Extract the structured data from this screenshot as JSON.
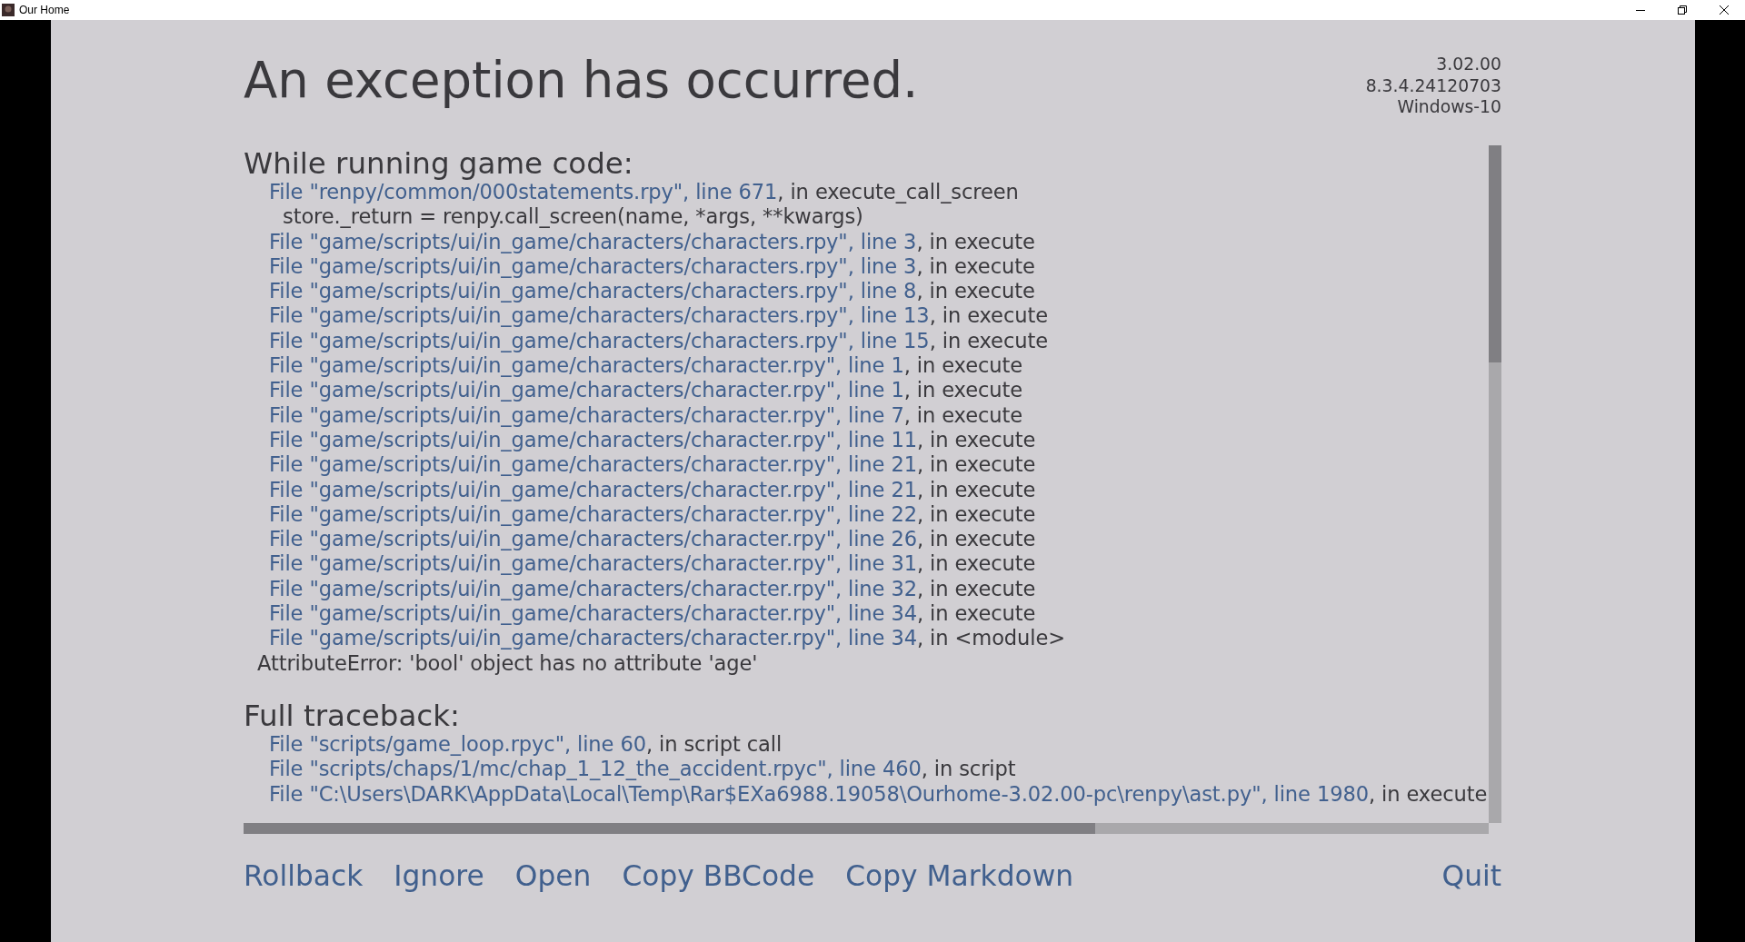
{
  "window": {
    "title": "Our Home"
  },
  "title": "An exception has occurred.",
  "version_info": [
    "3.02.00",
    "8.3.4.24120703",
    "Windows-10"
  ],
  "sections": [
    {
      "heading": "While running game code:",
      "entries": [
        {
          "kind": "frame",
          "link": "File \"renpy/common/000statements.rpy\", line 671",
          "rest": ", in execute_call_screen"
        },
        {
          "kind": "code",
          "text": "store._return = renpy.call_screen(name, *args, **kwargs)"
        },
        {
          "kind": "frame",
          "link": "File \"game/scripts/ui/in_game/characters/characters.rpy\", line 3",
          "rest": ", in execute"
        },
        {
          "kind": "frame",
          "link": "File \"game/scripts/ui/in_game/characters/characters.rpy\", line 3",
          "rest": ", in execute"
        },
        {
          "kind": "frame",
          "link": "File \"game/scripts/ui/in_game/characters/characters.rpy\", line 8",
          "rest": ", in execute"
        },
        {
          "kind": "frame",
          "link": "File \"game/scripts/ui/in_game/characters/characters.rpy\", line 13",
          "rest": ", in execute"
        },
        {
          "kind": "frame",
          "link": "File \"game/scripts/ui/in_game/characters/characters.rpy\", line 15",
          "rest": ", in execute"
        },
        {
          "kind": "frame",
          "link": "File \"game/scripts/ui/in_game/characters/character.rpy\", line 1",
          "rest": ", in execute"
        },
        {
          "kind": "frame",
          "link": "File \"game/scripts/ui/in_game/characters/character.rpy\", line 1",
          "rest": ", in execute"
        },
        {
          "kind": "frame",
          "link": "File \"game/scripts/ui/in_game/characters/character.rpy\", line 7",
          "rest": ", in execute"
        },
        {
          "kind": "frame",
          "link": "File \"game/scripts/ui/in_game/characters/character.rpy\", line 11",
          "rest": ", in execute"
        },
        {
          "kind": "frame",
          "link": "File \"game/scripts/ui/in_game/characters/character.rpy\", line 21",
          "rest": ", in execute"
        },
        {
          "kind": "frame",
          "link": "File \"game/scripts/ui/in_game/characters/character.rpy\", line 21",
          "rest": ", in execute"
        },
        {
          "kind": "frame",
          "link": "File \"game/scripts/ui/in_game/characters/character.rpy\", line 22",
          "rest": ", in execute"
        },
        {
          "kind": "frame",
          "link": "File \"game/scripts/ui/in_game/characters/character.rpy\", line 26",
          "rest": ", in execute"
        },
        {
          "kind": "frame",
          "link": "File \"game/scripts/ui/in_game/characters/character.rpy\", line 31",
          "rest": ", in execute"
        },
        {
          "kind": "frame",
          "link": "File \"game/scripts/ui/in_game/characters/character.rpy\", line 32",
          "rest": ", in execute"
        },
        {
          "kind": "frame",
          "link": "File \"game/scripts/ui/in_game/characters/character.rpy\", line 34",
          "rest": ", in execute"
        },
        {
          "kind": "frame",
          "link": "File \"game/scripts/ui/in_game/characters/character.rpy\", line 34",
          "rest": ", in <module>"
        },
        {
          "kind": "error",
          "text": "AttributeError: 'bool' object has no attribute 'age'"
        }
      ]
    },
    {
      "heading": "Full traceback:",
      "entries": [
        {
          "kind": "frame",
          "link": "File \"scripts/game_loop.rpyc\", line 60",
          "rest": ", in script call"
        },
        {
          "kind": "frame",
          "link": "File \"scripts/chaps/1/mc/chap_1_12_the_accident.rpyc\", line 460",
          "rest": ", in script"
        },
        {
          "kind": "frame",
          "link": "File \"C:\\Users\\DARK\\AppData\\Local\\Temp\\Rar$EXa6988.19058\\Ourhome-3.02.00-pc\\renpy\\ast.py\", line 1980",
          "rest": ", in execute"
        }
      ]
    }
  ],
  "buttons": [
    "Rollback",
    "Ignore",
    "Open",
    "Copy BBCode",
    "Copy Markdown"
  ],
  "quit_button": "Quit"
}
